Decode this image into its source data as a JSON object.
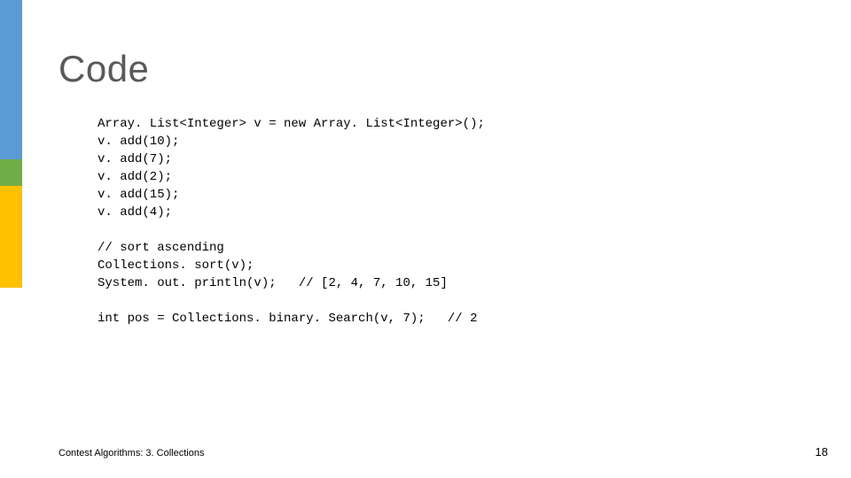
{
  "title": "Code",
  "code": "Array. List<Integer> v = new Array. List<Integer>();\nv. add(10);\nv. add(7);\nv. add(2);\nv. add(15);\nv. add(4);\n\n// sort ascending\nCollections. sort(v);\nSystem. out. println(v);   // [2, 4, 7, 10, 15]\n\nint pos = Collections. binary. Search(v, 7);   // 2",
  "footer": {
    "left": "Contest Algorithms: 3. Collections",
    "right": "18"
  }
}
